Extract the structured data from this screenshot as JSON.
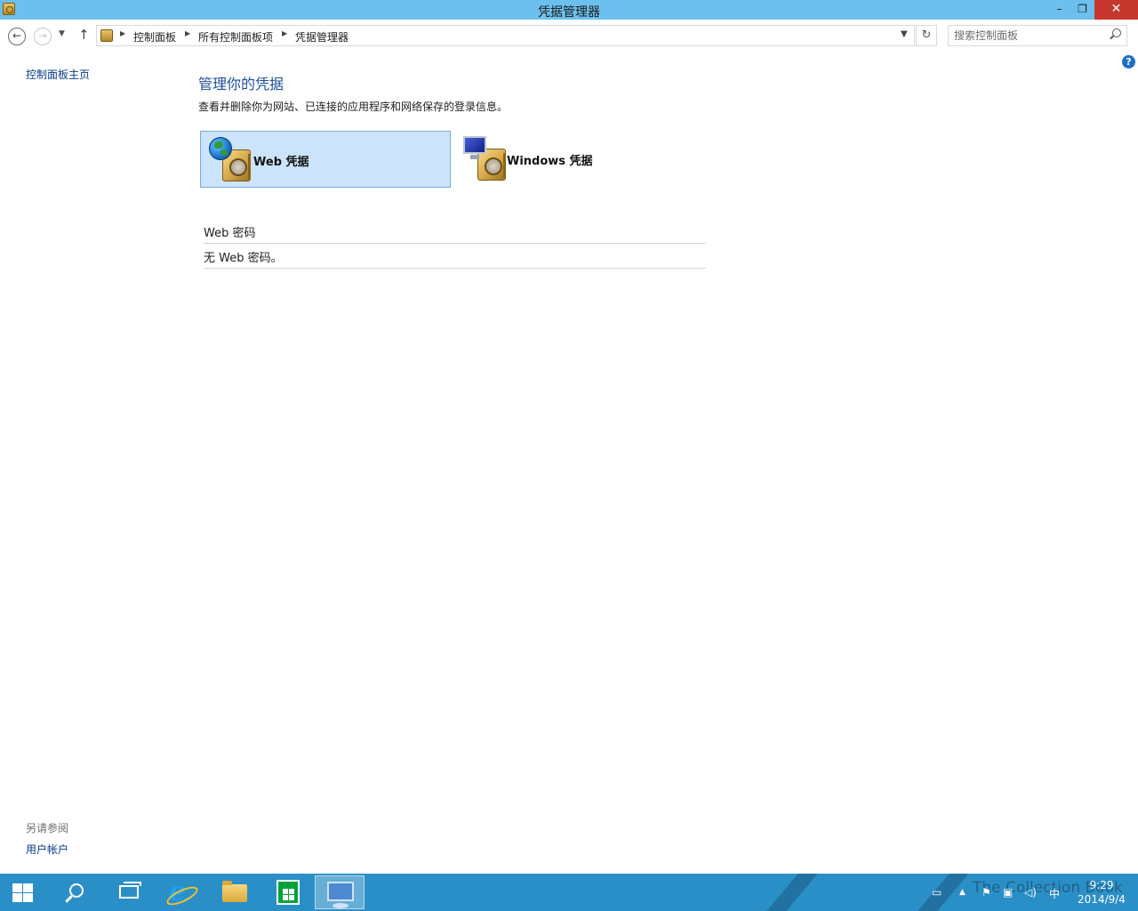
{
  "window": {
    "title": "凭据管理器",
    "minimize_label": "–",
    "restore_label": "❐",
    "close_label": "✕"
  },
  "navigation": {
    "back_label": "←",
    "forward_label": "→",
    "recent_label": "▼",
    "up_label": "↑",
    "breadcrumbs": [
      "控制面板",
      "所有控制面板项",
      "凭据管理器"
    ],
    "refresh_label": "↻",
    "search_placeholder": "搜索控制面板"
  },
  "left_pane": {
    "home_link": "控制面板主页",
    "see_also_title": "另请参阅",
    "see_also_links": [
      "用户帐户"
    ]
  },
  "main": {
    "title": "管理你的凭据",
    "description": "查看并删除你为网站、已连接的应用程序和网络保存的登录信息。",
    "credential_types": [
      {
        "label": "Web 凭据",
        "selected": true,
        "icon": "globe-safe-icon"
      },
      {
        "label": "Windows 凭据",
        "selected": false,
        "icon": "monitor-safe-icon"
      }
    ],
    "section_header": "Web 密码",
    "empty_message": "无 Web 密码。"
  },
  "help_label": "?",
  "taskbar": {
    "apps": [
      "start-icon",
      "search-icon",
      "task-view-icon",
      "ie-icon",
      "file-explorer-icon",
      "store-icon",
      "control-panel-icon"
    ],
    "active_app": "control-panel-icon",
    "tray": {
      "ime": "中",
      "time": "9:29",
      "date": "2014/9/4"
    },
    "watermark": "The Collection Book"
  },
  "colors": {
    "titlebar": "#6cc0ee",
    "taskbar": "#2b8fc7",
    "link": "#0a3a8c",
    "heading": "#1e4e9c",
    "selected_tile": "#cce4fb",
    "close_button": "#c7372d"
  }
}
